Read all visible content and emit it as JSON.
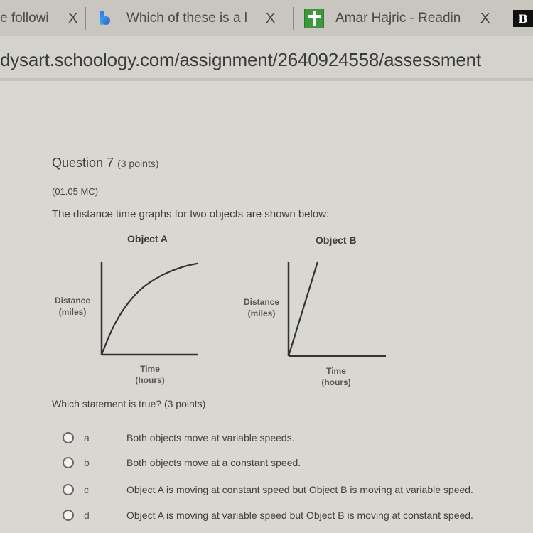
{
  "browser": {
    "tabs": [
      {
        "title": "e followi",
        "icon": "none"
      },
      {
        "title": "Which of these is a l",
        "icon": "bing-icon"
      },
      {
        "title": "Amar Hajric - Readin",
        "icon": "green-cross-icon"
      },
      {
        "title": "",
        "icon": "b-logo-icon",
        "letter": "B"
      }
    ],
    "close_glyph": "X",
    "url": "dysart.schoology.com/assignment/2640924558/assessment"
  },
  "question": {
    "title": "Question 7",
    "points": "(3 points)",
    "code": "(01.05 MC)",
    "prompt": "The distance time graphs for two objects are shown below:",
    "sub_prompt": "Which statement is true? (3 points)",
    "options": [
      {
        "letter": "a",
        "text": "Both objects move at variable speeds."
      },
      {
        "letter": "b",
        "text": "Both objects move at a constant speed."
      },
      {
        "letter": "c",
        "text": "Object A is moving at constant speed but Object B is moving at variable speed."
      },
      {
        "letter": "d",
        "text": "Object A is moving at variable speed but Object B is moving at constant speed."
      }
    ]
  },
  "chart_data": [
    {
      "type": "line",
      "title": "Object A",
      "xlabel": "Time\n(hours)",
      "ylabel": "Distance\n(miles)",
      "shape": "concave-down curve (decelerating)",
      "x": [
        0,
        0.1,
        0.2,
        0.3,
        0.4,
        0.5,
        0.6,
        0.7,
        0.8,
        0.9,
        1.0
      ],
      "y": [
        0,
        0.26,
        0.45,
        0.59,
        0.7,
        0.78,
        0.84,
        0.89,
        0.93,
        0.96,
        0.98
      ],
      "xlim": [
        0,
        1
      ],
      "ylim": [
        0,
        1
      ],
      "grid": false
    },
    {
      "type": "line",
      "title": "Object B",
      "xlabel": "Time\n(hours)",
      "ylabel": "Distance\n(miles)",
      "shape": "straight line (constant slope)",
      "x": [
        0,
        0.3
      ],
      "y": [
        0,
        1.0
      ],
      "xlim": [
        0,
        1
      ],
      "ylim": [
        0,
        1
      ],
      "grid": false
    }
  ]
}
